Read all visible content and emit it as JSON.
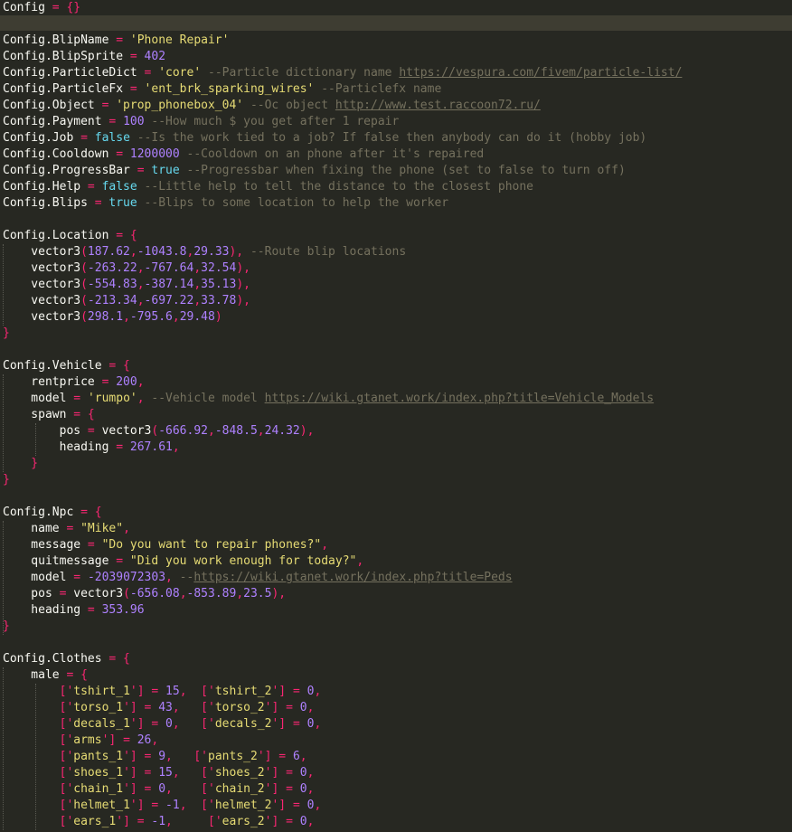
{
  "theme": {
    "background": "#272822",
    "current_line": "#3e3d32",
    "plain": "#f8f8f2",
    "operator": "#f92672",
    "string": "#e6db74",
    "number": "#ae81ff",
    "boolean": "#66d9ef",
    "comment": "#75715e"
  },
  "lines": [
    [
      [
        "p",
        "Config"
      ],
      [
        "o",
        " = "
      ],
      [
        "o",
        "{}"
      ]
    ],
    [],
    [
      [
        "p",
        "Config.BlipName"
      ],
      [
        "o",
        " = "
      ],
      [
        "s",
        "'Phone Repair'"
      ]
    ],
    [
      [
        "p",
        "Config.BlipSprite"
      ],
      [
        "o",
        " = "
      ],
      [
        "n",
        "402"
      ]
    ],
    [
      [
        "p",
        "Config.ParticleDict"
      ],
      [
        "o",
        " = "
      ],
      [
        "s",
        "'core'"
      ],
      [
        "c",
        " --Particle dictionary name "
      ],
      [
        "u",
        "https://vespura.com/fivem/particle-list/"
      ]
    ],
    [
      [
        "p",
        "Config.ParticleFx"
      ],
      [
        "o",
        " = "
      ],
      [
        "s",
        "'ent_brk_sparking_wires'"
      ],
      [
        "c",
        " --Particlefx name"
      ]
    ],
    [
      [
        "p",
        "Config.Object"
      ],
      [
        "o",
        " = "
      ],
      [
        "s",
        "'prop_phonebox_04'"
      ],
      [
        "c",
        " --Oc object "
      ],
      [
        "u",
        "http://www.test.raccoon72.ru/"
      ]
    ],
    [
      [
        "p",
        "Config.Payment"
      ],
      [
        "o",
        " = "
      ],
      [
        "n",
        "100"
      ],
      [
        "c",
        " --How much $ you get after 1 repair"
      ]
    ],
    [
      [
        "p",
        "Config.Job"
      ],
      [
        "o",
        " = "
      ],
      [
        "b",
        "false"
      ],
      [
        "c",
        " --Is the work tied to a job? If false then anybody can do it (hobby job)"
      ]
    ],
    [
      [
        "p",
        "Config.Cooldown"
      ],
      [
        "o",
        " = "
      ],
      [
        "n",
        "1200000"
      ],
      [
        "c",
        " --Cooldown on an phone after it's repaired"
      ]
    ],
    [
      [
        "p",
        "Config.ProgressBar"
      ],
      [
        "o",
        " = "
      ],
      [
        "b",
        "true"
      ],
      [
        "c",
        " --Progressbar when fixing the phone (set to false to turn off)"
      ]
    ],
    [
      [
        "p",
        "Config.Help"
      ],
      [
        "o",
        " = "
      ],
      [
        "b",
        "false"
      ],
      [
        "c",
        " --Little help to tell the distance to the closest phone"
      ]
    ],
    [
      [
        "p",
        "Config.Blips"
      ],
      [
        "o",
        " = "
      ],
      [
        "b",
        "true"
      ],
      [
        "c",
        " --Blips to some location to help the worker"
      ]
    ],
    [],
    [
      [
        "p",
        "Config.Location"
      ],
      [
        "o",
        " = {"
      ]
    ],
    [
      [
        "p",
        "    vector3"
      ],
      [
        "o",
        "("
      ],
      [
        "n",
        "187.62"
      ],
      [
        "o",
        ","
      ],
      [
        "n",
        "-1043.8"
      ],
      [
        "o",
        ","
      ],
      [
        "n",
        "29.33"
      ],
      [
        "o",
        "),"
      ],
      [
        "c",
        " --Route blip locations"
      ]
    ],
    [
      [
        "p",
        "    vector3"
      ],
      [
        "o",
        "("
      ],
      [
        "n",
        "-263.22"
      ],
      [
        "o",
        ","
      ],
      [
        "n",
        "-767.64"
      ],
      [
        "o",
        ","
      ],
      [
        "n",
        "32.54"
      ],
      [
        "o",
        "),"
      ]
    ],
    [
      [
        "p",
        "    vector3"
      ],
      [
        "o",
        "("
      ],
      [
        "n",
        "-554.83"
      ],
      [
        "o",
        ","
      ],
      [
        "n",
        "-387.14"
      ],
      [
        "o",
        ","
      ],
      [
        "n",
        "35.13"
      ],
      [
        "o",
        "),"
      ]
    ],
    [
      [
        "p",
        "    vector3"
      ],
      [
        "o",
        "("
      ],
      [
        "n",
        "-213.34"
      ],
      [
        "o",
        ","
      ],
      [
        "n",
        "-697.22"
      ],
      [
        "o",
        ","
      ],
      [
        "n",
        "33.78"
      ],
      [
        "o",
        "),"
      ]
    ],
    [
      [
        "p",
        "    vector3"
      ],
      [
        "o",
        "("
      ],
      [
        "n",
        "298.1"
      ],
      [
        "o",
        ","
      ],
      [
        "n",
        "-795.6"
      ],
      [
        "o",
        ","
      ],
      [
        "n",
        "29.48"
      ],
      [
        "o",
        ")"
      ]
    ],
    [
      [
        "o",
        "}"
      ]
    ],
    [],
    [
      [
        "p",
        "Config.Vehicle"
      ],
      [
        "o",
        " = {"
      ]
    ],
    [
      [
        "p",
        "    rentprice"
      ],
      [
        "o",
        " = "
      ],
      [
        "n",
        "200"
      ],
      [
        "o",
        ","
      ]
    ],
    [
      [
        "p",
        "    model"
      ],
      [
        "o",
        " = "
      ],
      [
        "s",
        "'rumpo'"
      ],
      [
        "o",
        ","
      ],
      [
        "c",
        " --Vehicle model "
      ],
      [
        "u",
        "https://wiki.gtanet.work/index.php?title=Vehicle_Models"
      ]
    ],
    [
      [
        "p",
        "    spawn"
      ],
      [
        "o",
        " = {"
      ]
    ],
    [
      [
        "p",
        "        pos"
      ],
      [
        "o",
        " = "
      ],
      [
        "p",
        "vector3"
      ],
      [
        "o",
        "("
      ],
      [
        "n",
        "-666.92"
      ],
      [
        "o",
        ","
      ],
      [
        "n",
        "-848.5"
      ],
      [
        "o",
        ","
      ],
      [
        "n",
        "24.32"
      ],
      [
        "o",
        "),"
      ]
    ],
    [
      [
        "p",
        "        heading"
      ],
      [
        "o",
        " = "
      ],
      [
        "n",
        "267.61"
      ],
      [
        "o",
        ","
      ]
    ],
    [
      [
        "o",
        "    }"
      ]
    ],
    [
      [
        "o",
        "}"
      ]
    ],
    [],
    [
      [
        "p",
        "Config.Npc"
      ],
      [
        "o",
        " = {"
      ]
    ],
    [
      [
        "p",
        "    name"
      ],
      [
        "o",
        " = "
      ],
      [
        "s",
        "\"Mike\""
      ],
      [
        "o",
        ","
      ]
    ],
    [
      [
        "p",
        "    message"
      ],
      [
        "o",
        " = "
      ],
      [
        "s",
        "\"Do you want to repair phones?\""
      ],
      [
        "o",
        ","
      ]
    ],
    [
      [
        "p",
        "    quitmessage"
      ],
      [
        "o",
        " = "
      ],
      [
        "s",
        "\"Did you work enough for today?\""
      ],
      [
        "o",
        ","
      ]
    ],
    [
      [
        "p",
        "    model"
      ],
      [
        "o",
        " = "
      ],
      [
        "n",
        "-2039072303"
      ],
      [
        "o",
        ","
      ],
      [
        "c",
        " --"
      ],
      [
        "u",
        "https://wiki.gtanet.work/index.php?title=Peds"
      ]
    ],
    [
      [
        "p",
        "    pos"
      ],
      [
        "o",
        " = "
      ],
      [
        "p",
        "vector3"
      ],
      [
        "o",
        "("
      ],
      [
        "n",
        "-656.08"
      ],
      [
        "o",
        ","
      ],
      [
        "n",
        "-853.89"
      ],
      [
        "o",
        ","
      ],
      [
        "n",
        "23.5"
      ],
      [
        "o",
        "),"
      ]
    ],
    [
      [
        "p",
        "    heading"
      ],
      [
        "o",
        " = "
      ],
      [
        "n",
        "353.96"
      ]
    ],
    [
      [
        "o",
        "}"
      ]
    ],
    [],
    [
      [
        "p",
        "Config.Clothes"
      ],
      [
        "o",
        " = {"
      ]
    ],
    [
      [
        "p",
        "    male"
      ],
      [
        "o",
        " = {"
      ]
    ],
    [
      [
        "o",
        "        ['"
      ],
      [
        "s",
        "tshirt_1"
      ],
      [
        "o",
        "'] = "
      ],
      [
        "n",
        "15"
      ],
      [
        "o",
        ",  ['"
      ],
      [
        "s",
        "tshirt_2"
      ],
      [
        "o",
        "'] = "
      ],
      [
        "n",
        "0"
      ],
      [
        "o",
        ","
      ]
    ],
    [
      [
        "o",
        "        ['"
      ],
      [
        "s",
        "torso_1"
      ],
      [
        "o",
        "'] = "
      ],
      [
        "n",
        "43"
      ],
      [
        "o",
        ",   ['"
      ],
      [
        "s",
        "torso_2"
      ],
      [
        "o",
        "'] = "
      ],
      [
        "n",
        "0"
      ],
      [
        "o",
        ","
      ]
    ],
    [
      [
        "o",
        "        ['"
      ],
      [
        "s",
        "decals_1"
      ],
      [
        "o",
        "'] = "
      ],
      [
        "n",
        "0"
      ],
      [
        "o",
        ",   ['"
      ],
      [
        "s",
        "decals_2"
      ],
      [
        "o",
        "'] = "
      ],
      [
        "n",
        "0"
      ],
      [
        "o",
        ","
      ]
    ],
    [
      [
        "o",
        "        ['"
      ],
      [
        "s",
        "arms"
      ],
      [
        "o",
        "'] = "
      ],
      [
        "n",
        "26"
      ],
      [
        "o",
        ","
      ]
    ],
    [
      [
        "o",
        "        ['"
      ],
      [
        "s",
        "pants_1"
      ],
      [
        "o",
        "'] = "
      ],
      [
        "n",
        "9"
      ],
      [
        "o",
        ",   ['"
      ],
      [
        "s",
        "pants_2"
      ],
      [
        "o",
        "'] = "
      ],
      [
        "n",
        "6"
      ],
      [
        "o",
        ","
      ]
    ],
    [
      [
        "o",
        "        ['"
      ],
      [
        "s",
        "shoes_1"
      ],
      [
        "o",
        "'] = "
      ],
      [
        "n",
        "15"
      ],
      [
        "o",
        ",   ['"
      ],
      [
        "s",
        "shoes_2"
      ],
      [
        "o",
        "'] = "
      ],
      [
        "n",
        "0"
      ],
      [
        "o",
        ","
      ]
    ],
    [
      [
        "o",
        "        ['"
      ],
      [
        "s",
        "chain_1"
      ],
      [
        "o",
        "'] = "
      ],
      [
        "n",
        "0"
      ],
      [
        "o",
        ",    ['"
      ],
      [
        "s",
        "chain_2"
      ],
      [
        "o",
        "'] = "
      ],
      [
        "n",
        "0"
      ],
      [
        "o",
        ","
      ]
    ],
    [
      [
        "o",
        "        ['"
      ],
      [
        "s",
        "helmet_1"
      ],
      [
        "o",
        "'] = "
      ],
      [
        "n",
        "-1"
      ],
      [
        "o",
        ",  ['"
      ],
      [
        "s",
        "helmet_2"
      ],
      [
        "o",
        "'] = "
      ],
      [
        "n",
        "0"
      ],
      [
        "o",
        ","
      ]
    ],
    [
      [
        "o",
        "        ['"
      ],
      [
        "s",
        "ears_1"
      ],
      [
        "o",
        "'] = "
      ],
      [
        "n",
        "-1"
      ],
      [
        "o",
        ",     ['"
      ],
      [
        "s",
        "ears_2"
      ],
      [
        "o",
        "'] = "
      ],
      [
        "n",
        "0"
      ],
      [
        "o",
        ","
      ]
    ]
  ]
}
